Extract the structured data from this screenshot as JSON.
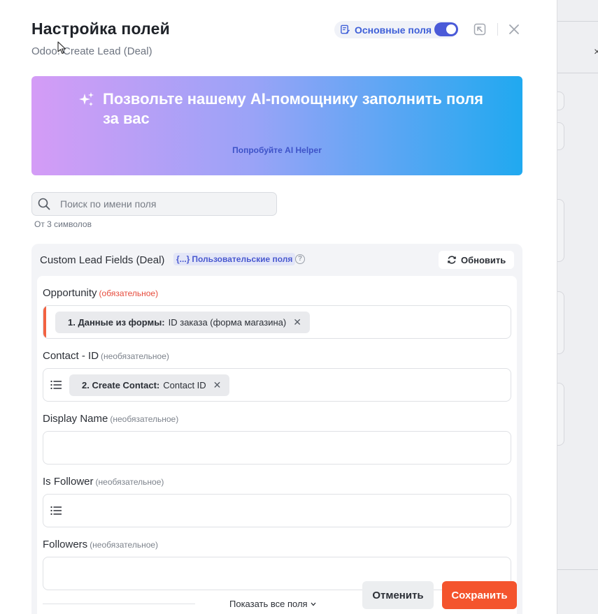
{
  "header": {
    "title": "Настройка полей",
    "subtitle": "Odoo: Create Lead (Deal)",
    "basic_fields_label": "Основные поля",
    "basic_fields_enabled": true
  },
  "ai_banner": {
    "headline": "Позвольте нашему AI-помощнику заполнить поля за вас",
    "link_label": "Попробуйте AI Helper"
  },
  "search": {
    "placeholder": "Поиск по имени поля",
    "value": "",
    "hint": "От 3 символов"
  },
  "section": {
    "title": "Custom Lead Fields (Deal)",
    "badge_label": "Пользовательские поля",
    "badge_icon": "{...}",
    "refresh_label": "Обновить"
  },
  "fields": [
    {
      "label": "Opportunity",
      "qualifier": "(обязательное)",
      "chip_source": "1. Данные из формы:",
      "chip_value": "ID заказа (форма магазина)"
    },
    {
      "label": "Contact - ID",
      "qualifier": "(необязательное)",
      "chip_source": "2. Create Contact:",
      "chip_value": "Contact ID"
    },
    {
      "label": "Display Name",
      "qualifier": "(необязательное)"
    },
    {
      "label": "Is Follower",
      "qualifier": "(необязательное)"
    },
    {
      "label": "Followers",
      "qualifier": "(необязательное)"
    }
  ],
  "footer": {
    "show_all_label": "Показать все поля",
    "cancel_label": "Отменить",
    "save_label": "Сохранить"
  },
  "colors": {
    "accent": "#4a5ad8",
    "save": "#f4542d",
    "required": "#e64b3c"
  }
}
